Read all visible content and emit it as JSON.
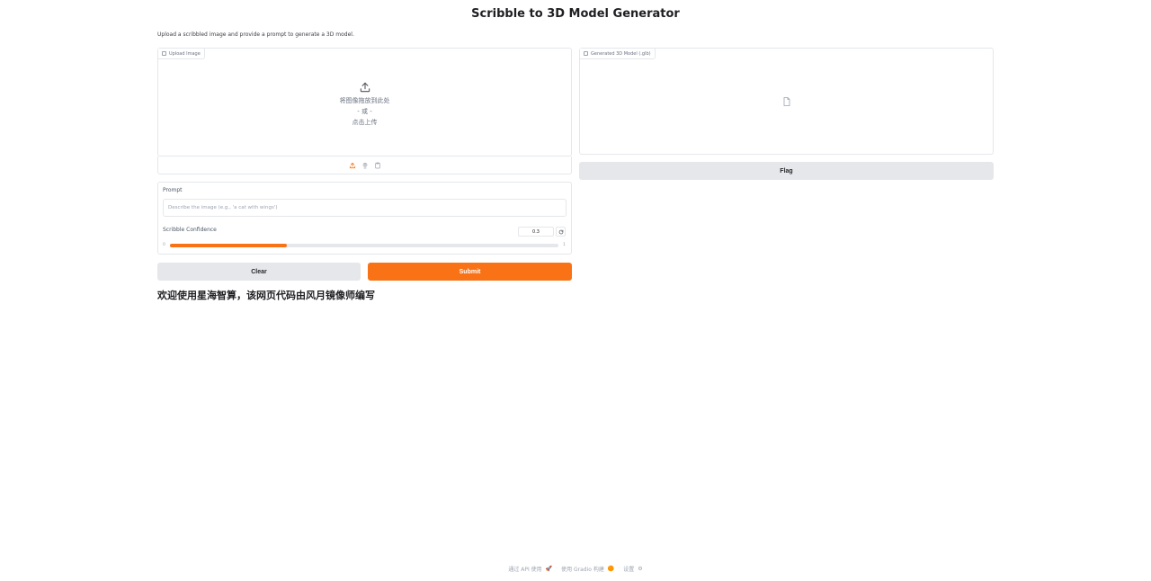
{
  "header": {
    "title": "Scribble to 3D Model Generator",
    "description": "Upload a scribbled image and provide a prompt to generate a 3D model."
  },
  "upload": {
    "label": "Upload Image",
    "drop_text": "将图像拖放到此处",
    "or_text": "- 或 -",
    "click_text": "点击上传",
    "toolbar_icons": [
      "upload-icon",
      "webcam-icon",
      "clipboard-icon"
    ]
  },
  "output": {
    "label": "Generated 3D Model (.glb)",
    "flag_label": "Flag"
  },
  "form": {
    "prompt_label": "Prompt",
    "prompt_placeholder": "Describe the image (e.g., 'a cat with wings')",
    "slider_label": "Scribble Confidence",
    "slider_value": "0.3",
    "slider_min": "0",
    "slider_max": "1",
    "slider_fraction": 0.3
  },
  "actions": {
    "clear_label": "Clear",
    "submit_label": "Submit"
  },
  "welcome": "欢迎使用星海智算，该网页代码由风月镜像师编写",
  "footer": {
    "api": "通过 API 使用",
    "built": "使用 Gradio 构建",
    "settings": "设置",
    "sep": "·"
  },
  "colors": {
    "accent": "#f97316",
    "button_gray": "#e5e7eb"
  }
}
